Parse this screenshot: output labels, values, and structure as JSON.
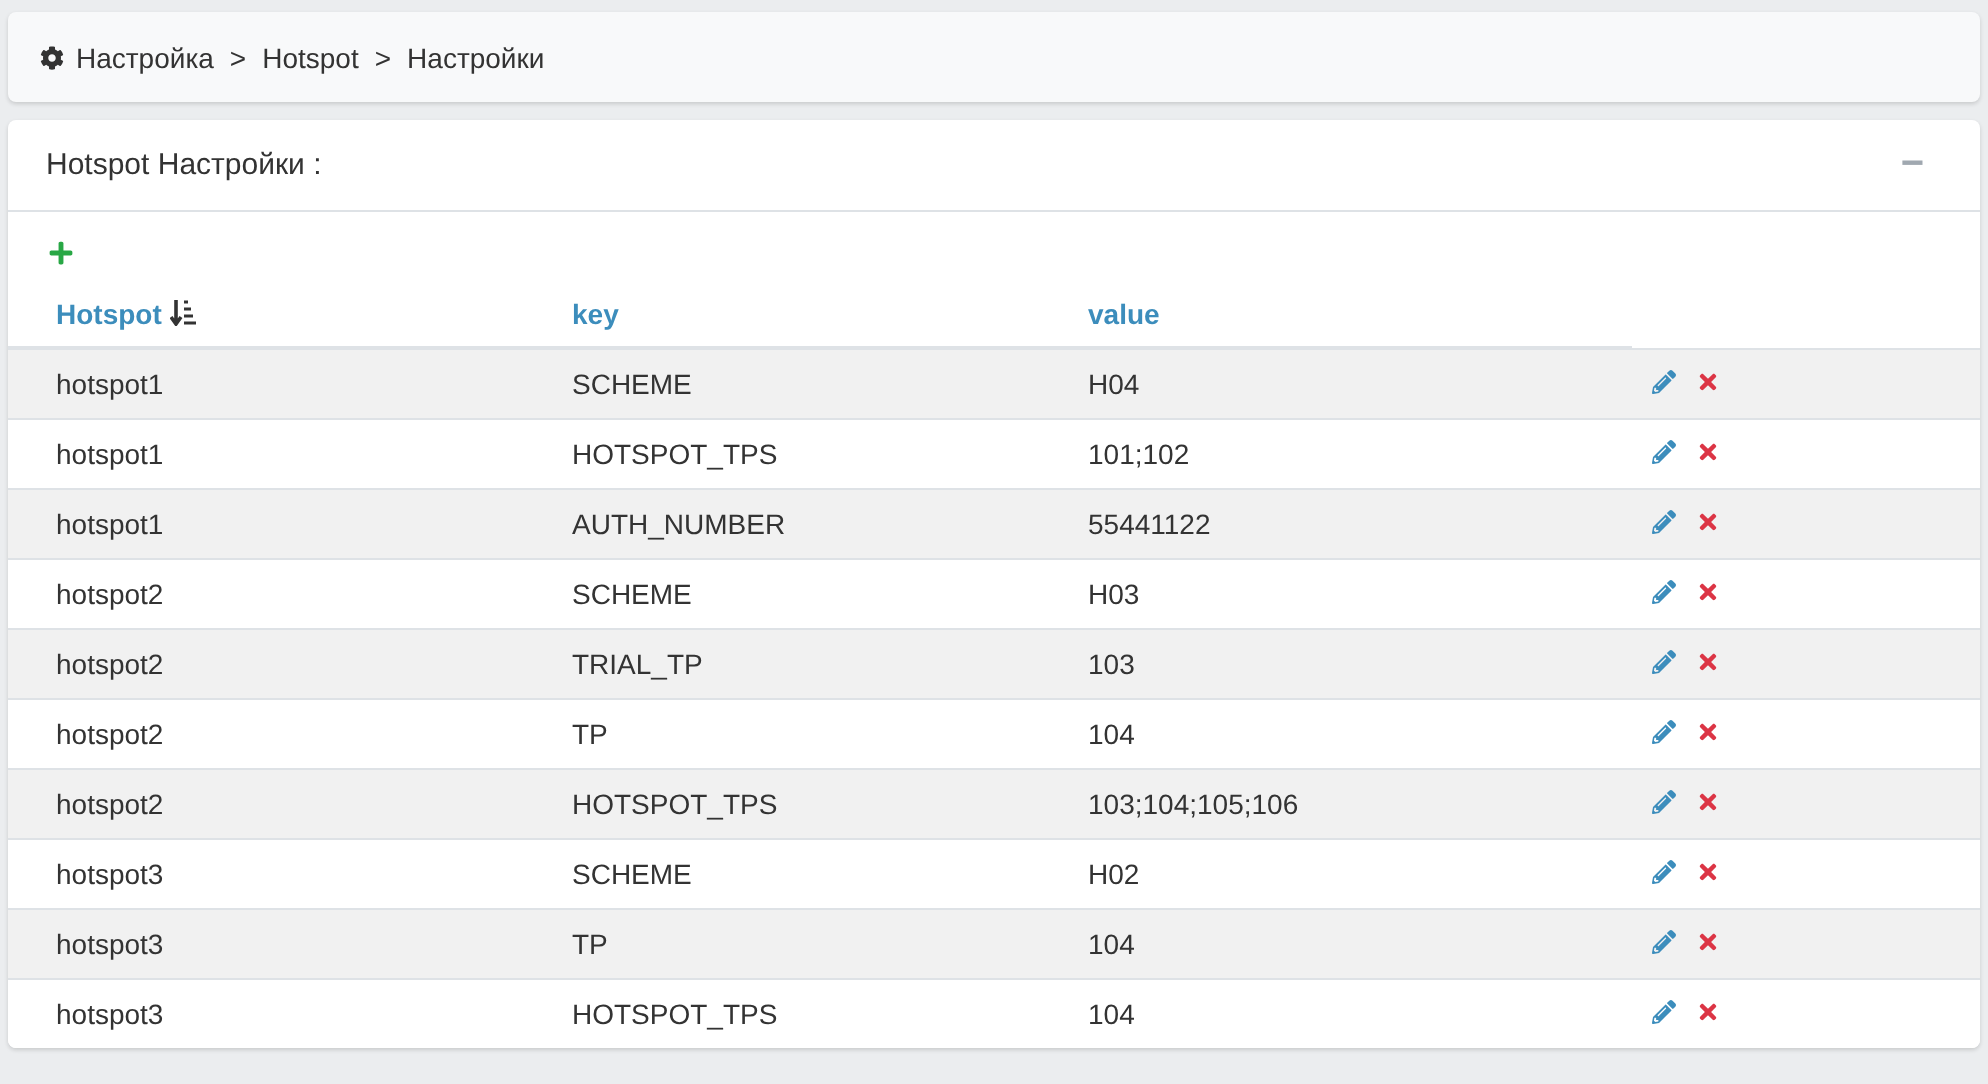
{
  "breadcrumb": [
    "Настройка",
    "Hotspot",
    "Настройки"
  ],
  "breadcrumb_separator": ">",
  "panel": {
    "title": "Hotspot Настройки :",
    "collapse_symbol": "−"
  },
  "table": {
    "columns": [
      {
        "label": "Hotspot",
        "sorted": true
      },
      {
        "label": "key",
        "sorted": false
      },
      {
        "label": "value",
        "sorted": false
      }
    ],
    "rows": [
      {
        "hotspot": "hotspot1",
        "key": "SCHEME",
        "value": "H04"
      },
      {
        "hotspot": "hotspot1",
        "key": "HOTSPOT_TPS",
        "value": "101;102"
      },
      {
        "hotspot": "hotspot1",
        "key": "AUTH_NUMBER",
        "value": "55441122"
      },
      {
        "hotspot": "hotspot2",
        "key": "SCHEME",
        "value": "H03"
      },
      {
        "hotspot": "hotspot2",
        "key": "TRIAL_TP",
        "value": "103"
      },
      {
        "hotspot": "hotspot2",
        "key": "TP",
        "value": "104"
      },
      {
        "hotspot": "hotspot2",
        "key": "HOTSPOT_TPS",
        "value": "103;104;105;106"
      },
      {
        "hotspot": "hotspot3",
        "key": "SCHEME",
        "value": "H02"
      },
      {
        "hotspot": "hotspot3",
        "key": "TP",
        "value": "104"
      },
      {
        "hotspot": "hotspot3",
        "key": "HOTSPOT_TPS",
        "value": "104"
      }
    ]
  }
}
